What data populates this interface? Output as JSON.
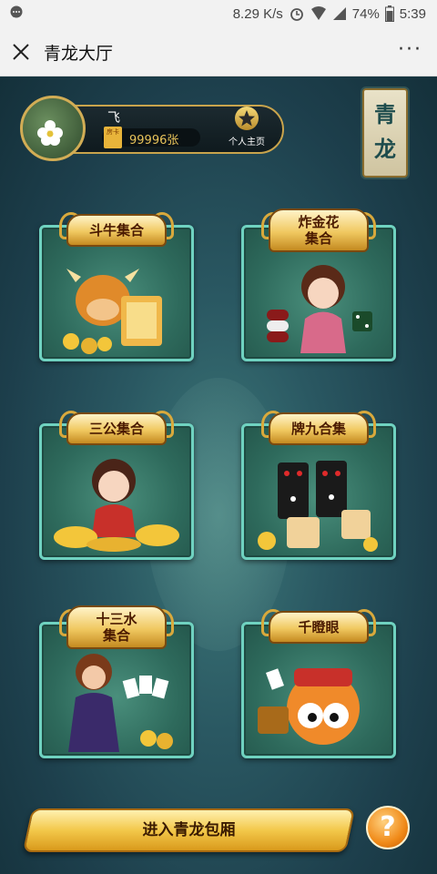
{
  "status_bar": {
    "speed": "8.29 K/s",
    "battery": "74%",
    "time": "5:39"
  },
  "app_bar": {
    "title": "青龙大厅",
    "more": "···"
  },
  "profile": {
    "name": "飞",
    "card_icon_text": "房卡",
    "card_count": "99996张",
    "home_label": "个人主页"
  },
  "badge": {
    "text": "青龙"
  },
  "games": [
    {
      "label": "斗牛集合"
    },
    {
      "label": "炸金花\n集合"
    },
    {
      "label": "三公集合"
    },
    {
      "label": "牌九合集"
    },
    {
      "label": "十三水\n集合"
    },
    {
      "label": "千瞪眼"
    }
  ],
  "bottom": {
    "enter_label": "进入青龙包厢",
    "help_icon": "?"
  },
  "colors": {
    "frame_border": "#6fd2c0",
    "gold": "#f0c860",
    "accent_orange": "#f08a18"
  }
}
